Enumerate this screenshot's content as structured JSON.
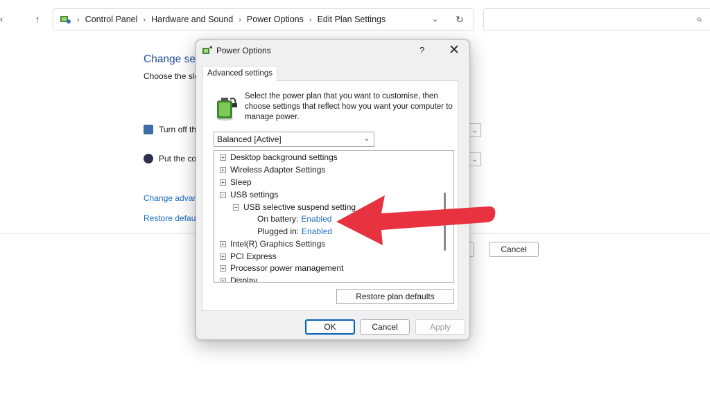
{
  "explorer": {
    "back_glyph": "‹",
    "up_glyph": "↑",
    "breadcrumbs": [
      "Control Panel",
      "Hardware and Sound",
      "Power Options",
      "Edit Plan Settings"
    ],
    "separator": "›",
    "dropdown_glyph": "⌄",
    "refresh_glyph": "↻",
    "search_glyph": "⌕"
  },
  "background": {
    "title": "Change set",
    "subtitle": "Choose the sle",
    "row1": "Turn off th",
    "row2": "Put the co",
    "link1": "Change advan",
    "link2": "Restore defaul",
    "cancel": "Cancel",
    "save_fragment": "s"
  },
  "dialog": {
    "title": "Power Options",
    "help": "?",
    "close": "✕",
    "tab": "Advanced settings",
    "description": "Select the power plan that you want to customise, then choose settings that reflect how you want your computer to manage power.",
    "plan": "Balanced [Active]",
    "tree": {
      "items": [
        {
          "expander": "+",
          "label": "Desktop background settings"
        },
        {
          "expander": "+",
          "label": "Wireless Adapter Settings"
        },
        {
          "expander": "+",
          "label": "Sleep"
        },
        {
          "expander": "−",
          "label": "USB settings"
        },
        {
          "expander": "−",
          "label": "USB selective suspend setting"
        },
        {
          "label": "On battery:",
          "value": "Enabled"
        },
        {
          "label": "Plugged in:",
          "value": "Enabled"
        },
        {
          "expander": "+",
          "label": "Intel(R) Graphics Settings"
        },
        {
          "expander": "+",
          "label": "PCI Express"
        },
        {
          "expander": "+",
          "label": "Processor power management"
        },
        {
          "expander": "+",
          "label": "Display"
        }
      ]
    },
    "restore": "Restore plan defaults",
    "ok": "OK",
    "cancel": "Cancel",
    "apply": "Apply"
  },
  "colors": {
    "link": "#1f6ec4",
    "accent": "#005fb8",
    "arrow": "#e8323f"
  }
}
